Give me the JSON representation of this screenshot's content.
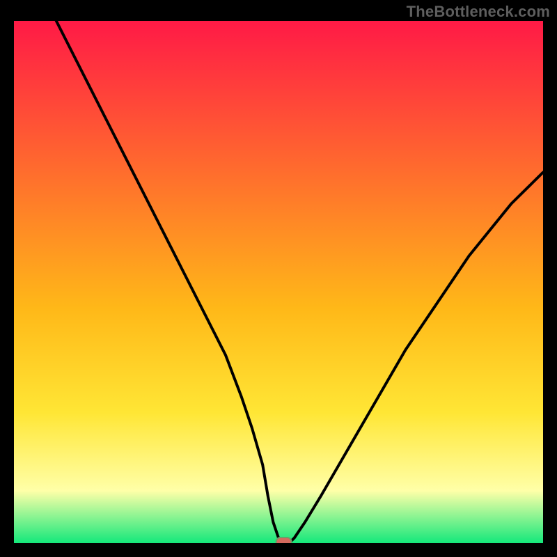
{
  "attribution": "TheBottleneck.com",
  "colors": {
    "background": "#000000",
    "attribution_text": "#5e5e5e",
    "gradient_top": "#ff1a46",
    "gradient_mid_upper": "#ff6a2e",
    "gradient_mid": "#ffb818",
    "gradient_mid_lower": "#ffe635",
    "gradient_pale": "#ffffa8",
    "gradient_bottom": "#14e87b",
    "curve": "#000000",
    "marker_fill": "#d46a5e",
    "marker_stroke": "#6aa06a"
  },
  "chart_data": {
    "type": "line",
    "title": "",
    "xlabel": "",
    "ylabel": "",
    "xlim": [
      0,
      100
    ],
    "ylim": [
      0,
      100
    ],
    "grid": false,
    "legend": false,
    "series": [
      {
        "name": "bottleneck-curve",
        "x": [
          8,
          12,
          16,
          20,
          24,
          28,
          32,
          36,
          40,
          43,
          45,
          47,
          48,
          49,
          50,
          51,
          52,
          53,
          55,
          58,
          62,
          66,
          70,
          74,
          78,
          82,
          86,
          90,
          94,
          98,
          100
        ],
        "y": [
          100,
          92,
          84,
          76,
          68,
          60,
          52,
          44,
          36,
          28,
          22,
          15,
          9,
          4,
          1,
          0,
          0,
          1,
          4,
          9,
          16,
          23,
          30,
          37,
          43,
          49,
          55,
          60,
          65,
          69,
          71
        ]
      }
    ],
    "marker": {
      "x": 51,
      "y": 0
    },
    "annotations": []
  }
}
